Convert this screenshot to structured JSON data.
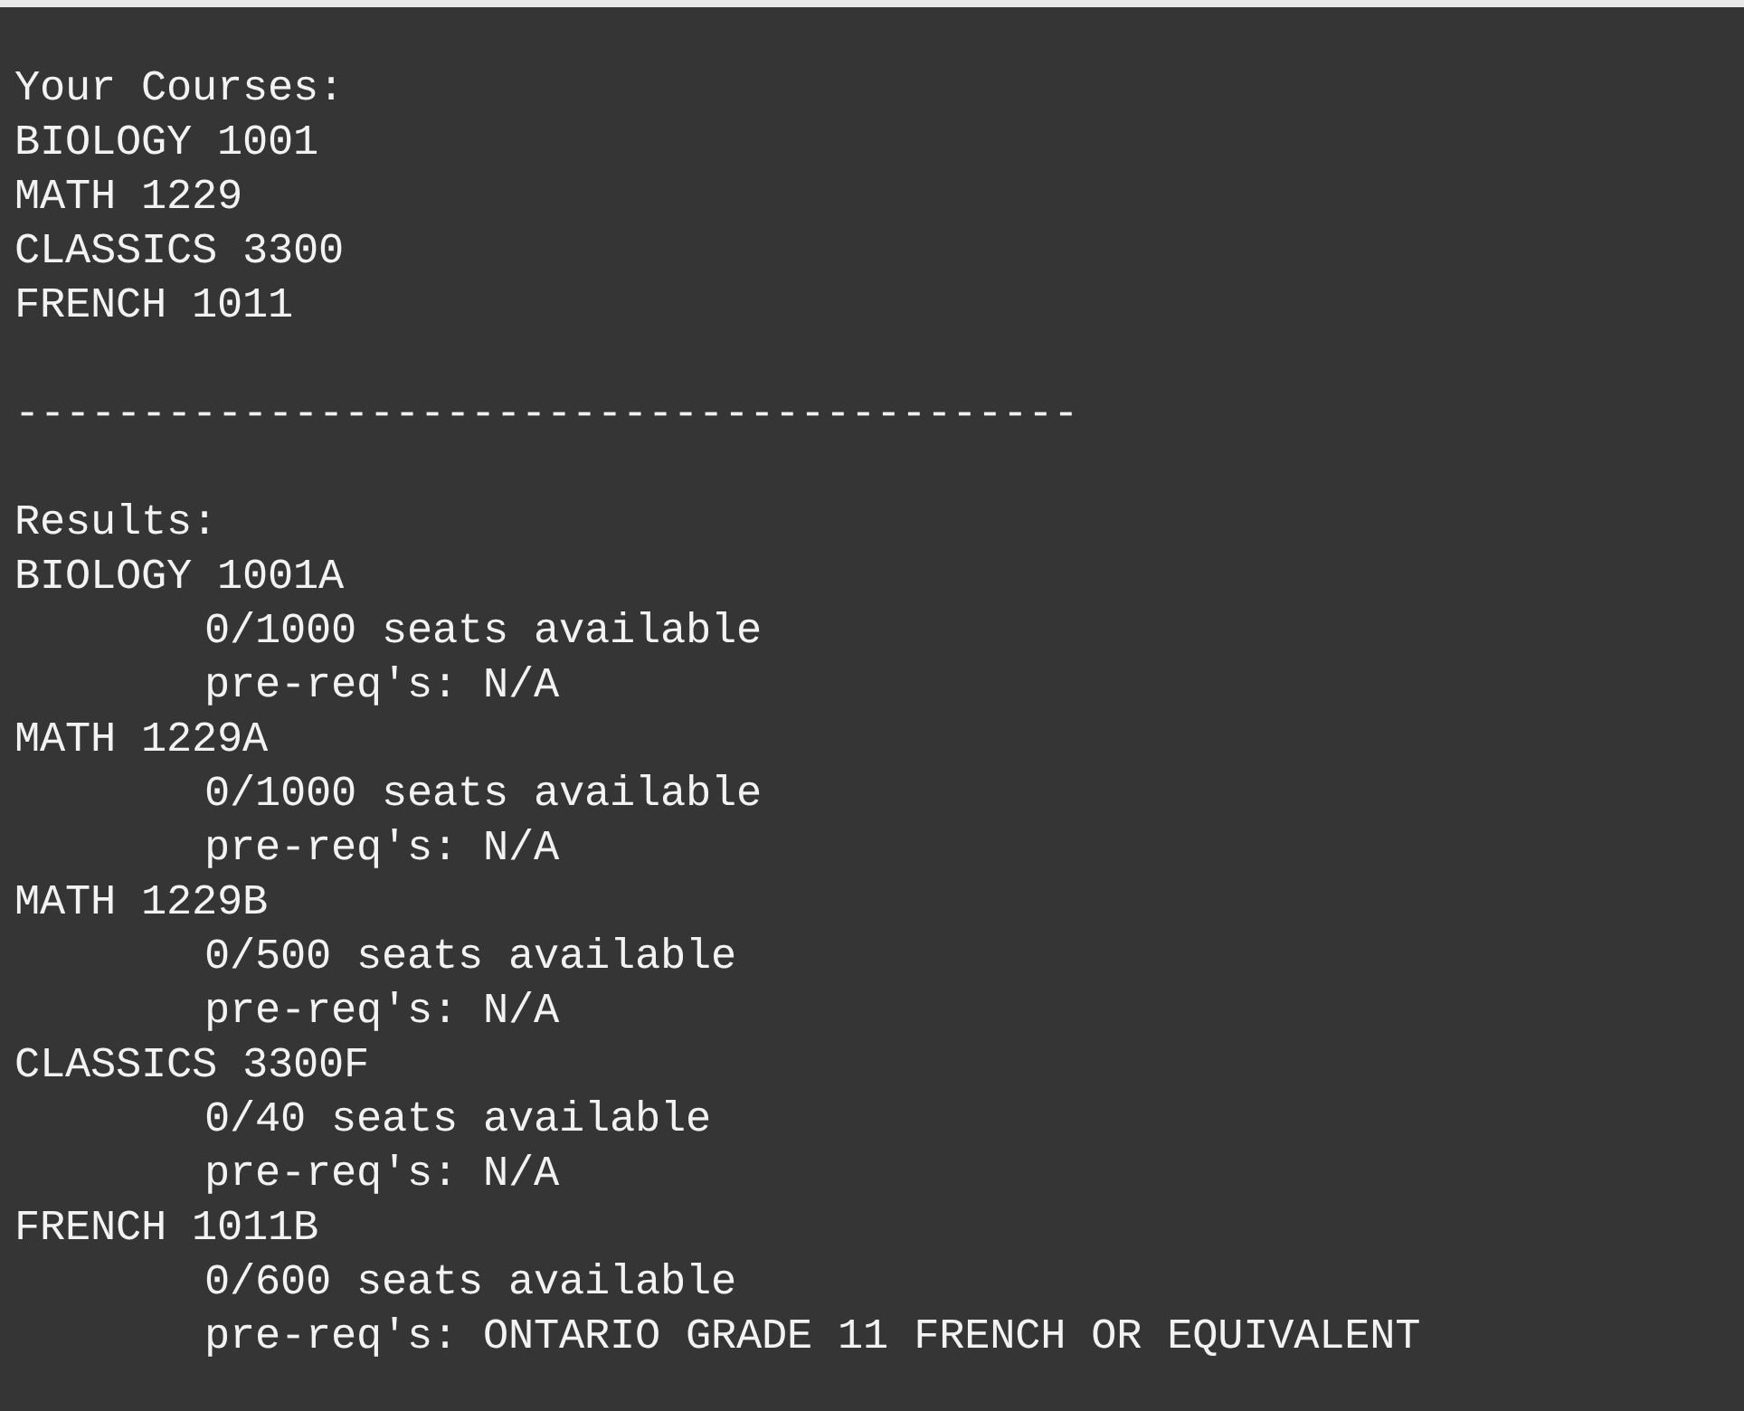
{
  "courses_heading": "Your Courses:",
  "courses": [
    "BIOLOGY 1001",
    "MATH 1229",
    "CLASSICS 3300",
    "FRENCH 1011"
  ],
  "separator": "------------------------------------------",
  "results_heading": "Results:",
  "results": [
    {
      "section": "BIOLOGY 1001A",
      "seats": "0/1000 seats available",
      "prereq": "pre-req's: N/A"
    },
    {
      "section": "MATH 1229A",
      "seats": "0/1000 seats available",
      "prereq": "pre-req's: N/A"
    },
    {
      "section": "MATH 1229B",
      "seats": "0/500 seats available",
      "prereq": "pre-req's: N/A"
    },
    {
      "section": "CLASSICS 3300F",
      "seats": "0/40 seats available",
      "prereq": "pre-req's: N/A"
    },
    {
      "section": "FRENCH 1011B",
      "seats": "0/600 seats available",
      "prereq": "pre-req's: ONTARIO GRADE 11 FRENCH OR EQUIVALENT"
    }
  ]
}
